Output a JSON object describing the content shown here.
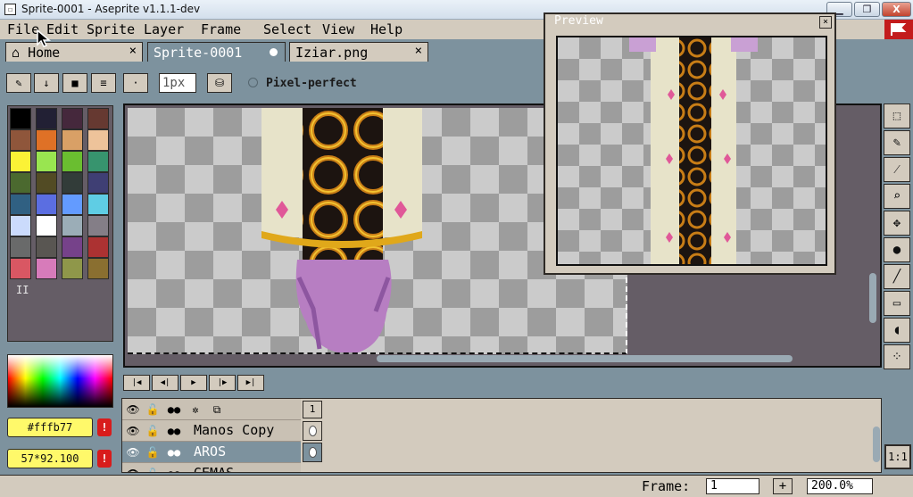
{
  "window": {
    "title": "Sprite-0001 - Aseprite v1.1.1-dev",
    "controls": {
      "minimize": "▁",
      "maximize": "❐",
      "close": "X"
    }
  },
  "menu": [
    "File",
    "Edit",
    "Sprite",
    "Layer",
    "Frame",
    "Select",
    "View",
    "Help"
  ],
  "tabs": [
    {
      "label": "Home",
      "close": "×",
      "icon": "home-icon"
    },
    {
      "label": "Sprite-0001",
      "active": true,
      "modified": true
    },
    {
      "label": "Iziar.png",
      "close": "×"
    }
  ],
  "toolbar": {
    "brush_size": "1px",
    "pixel_perfect_label": "Pixel-perfect",
    "buttons": [
      "pencil-icon",
      "arrow-down-icon",
      "folder-icon",
      "menu-icon",
      "dot-icon",
      "ink-icon"
    ]
  },
  "palette": {
    "colors": [
      "#000000",
      "#222034",
      "#45283c",
      "#663931",
      "#8f563b",
      "#df7126",
      "#d9a066",
      "#eec39a",
      "#fbf236",
      "#99e550",
      "#6abe30",
      "#37946e",
      "#4b692f",
      "#524b24",
      "#323c39",
      "#3f3f74",
      "#306082",
      "#5b6ee1",
      "#639bff",
      "#5fcde4",
      "#cbdbfc",
      "#ffffff",
      "#9badb7",
      "#847e87",
      "#696a6a",
      "#595652",
      "#76428a",
      "#ac3232",
      "#d95763",
      "#d77bba",
      "#8f974a",
      "#8a6f30"
    ],
    "handle": "II"
  },
  "colors": {
    "foreground": "#fffb77",
    "background": "57*92.100",
    "warning_glyph": "!",
    "accent": "#c31c1c"
  },
  "preview": {
    "title": "Preview",
    "close": "×"
  },
  "tools": [
    "marquee-icon",
    "pencil-icon",
    "eyedropper-icon",
    "zoom-icon",
    "move-icon",
    "fill-icon",
    "line-icon",
    "rectangle-icon",
    "blur-icon",
    "spray-icon"
  ],
  "animation": {
    "buttons": [
      "first-frame-icon",
      "prev-frame-icon",
      "play-icon",
      "next-frame-icon",
      "last-frame-icon"
    ],
    "glyphs": [
      "|◀",
      "◀|",
      "▶",
      "|▶",
      "▶|"
    ]
  },
  "timeline": {
    "frame_number": "1",
    "layers": [
      {
        "name": "Manos Copy",
        "selected": false
      },
      {
        "name": "AROS",
        "selected": true
      },
      {
        "name": "GEMAS",
        "selected": false
      }
    ]
  },
  "status": {
    "frame_label": "Frame:",
    "frame_value": "1",
    "add": "+",
    "zoom": "200.0%",
    "zoom_fit": "1:1"
  }
}
